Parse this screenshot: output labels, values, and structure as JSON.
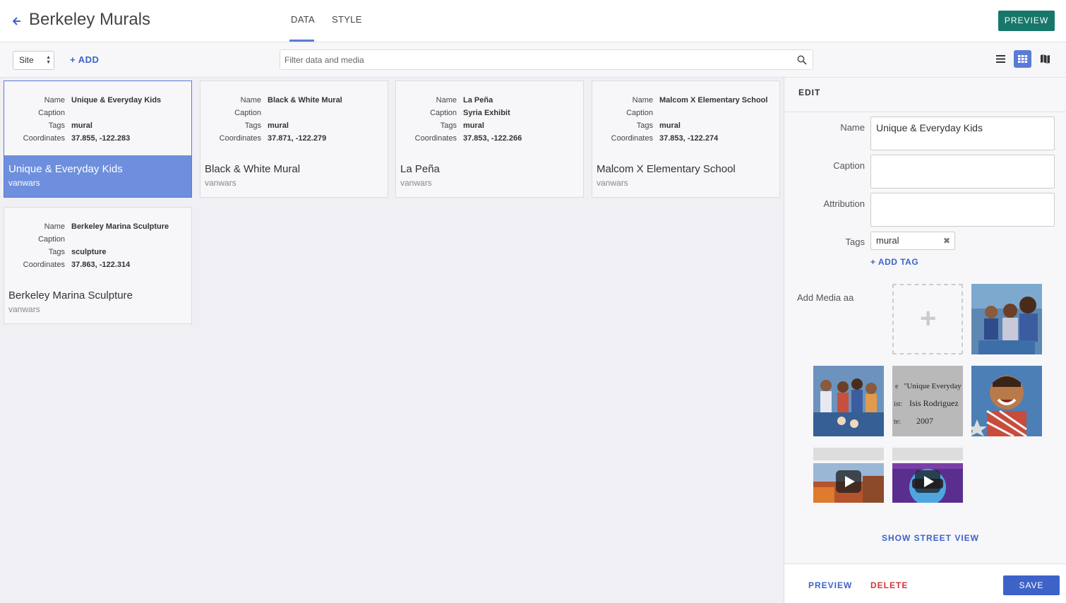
{
  "header": {
    "title": "Berkeley Murals",
    "tabs": [
      {
        "label": "DATA",
        "active": true
      },
      {
        "label": "STYLE",
        "active": false
      }
    ],
    "preview_label": "PREVIEW"
  },
  "toolbar": {
    "type_select": "Site",
    "add_label": "ADD",
    "filter_placeholder": "Filter data and media",
    "active_view": "grid"
  },
  "field_labels": {
    "name": "Name",
    "caption": "Caption",
    "tags": "Tags",
    "coordinates": "Coordinates"
  },
  "cards": [
    {
      "name": "Unique & Everyday Kids",
      "caption": "",
      "tags": "mural",
      "coordinates": "37.855, -122.283",
      "owner": "vanwars",
      "selected": true
    },
    {
      "name": "Black & White Mural",
      "caption": "",
      "tags": "mural",
      "coordinates": "37.871, -122.279",
      "owner": "vanwars",
      "selected": false
    },
    {
      "name": "La Peña",
      "caption": "Syria Exhibit",
      "tags": "mural",
      "coordinates": "37.853, -122.266",
      "owner": "vanwars",
      "selected": false
    },
    {
      "name": "Malcom X Elementary School",
      "caption": "",
      "tags": "mural",
      "coordinates": "37.853, -122.274",
      "owner": "vanwars",
      "selected": false
    },
    {
      "name": "Berkeley Marina Sculpture",
      "caption": "",
      "tags": "sculpture",
      "coordinates": "37.863, -122.314",
      "owner": "vanwars",
      "selected": false
    }
  ],
  "edit": {
    "heading": "EDIT",
    "labels": {
      "name": "Name",
      "caption": "Caption",
      "attribution": "Attribution",
      "tags": "Tags",
      "add_media": "Add Media aa"
    },
    "values": {
      "name": "Unique & Everyday Kids",
      "caption": "",
      "attribution": ""
    },
    "tags": [
      "mural"
    ],
    "add_tag_label": "ADD TAG",
    "media_thumb_text": {
      "line1": "\"Unique Everyday",
      "line2": "Isis Rodriguez",
      "line3": "2007",
      "prefix1": "e",
      "prefix2": "ist:",
      "prefix3": "te:"
    },
    "street_view_label": "SHOW STREET VIEW",
    "preview_label": "PREVIEW",
    "delete_label": "DELETE",
    "save_label": "SAVE"
  },
  "colors": {
    "accent": "#3d63c9",
    "selected": "#6e8fdd",
    "teal": "#17776b",
    "danger": "#d0343a"
  },
  "icons": [
    "back-arrow-icon",
    "plus-icon",
    "search-icon",
    "list-view-icon",
    "grid-view-icon",
    "map-view-icon",
    "close-icon",
    "play-icon"
  ]
}
